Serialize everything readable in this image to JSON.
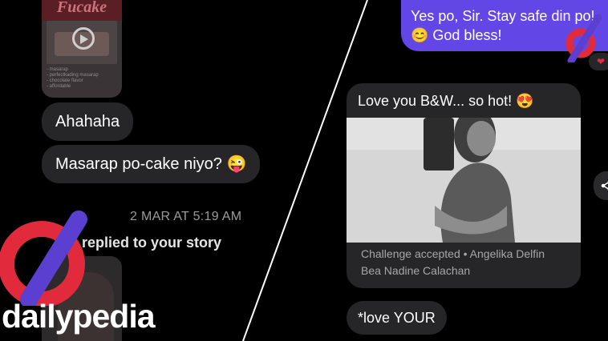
{
  "left": {
    "story_brand": "Fucake",
    "story_caption": [
      "- masarap",
      "- perfectkading masarap",
      "- chocolate flavor",
      "- affordable"
    ],
    "messages": [
      "Ahahaha",
      "Masarap po-cake niyo? 😜"
    ],
    "timestamp": "2 MAR AT 5:19 AM",
    "replied_label": "replied to your story"
  },
  "right": {
    "sent_message": "Yes po, Sir. Stay safe din po! 😊 God bless!",
    "reaction": "❤",
    "card": {
      "text": "Love you B&W... so hot! 😍",
      "caption_line1": "Challenge accepted • Angelika Delfin",
      "caption_line2": "Bea Nadine Calachan"
    },
    "correction": "*love YOUR"
  },
  "watermark": {
    "text": "dailypedia"
  },
  "colors": {
    "bubble": "#262628",
    "sent": "#6247e6",
    "accent_red": "#e22a3d",
    "accent_purple": "#5b3fd0"
  }
}
